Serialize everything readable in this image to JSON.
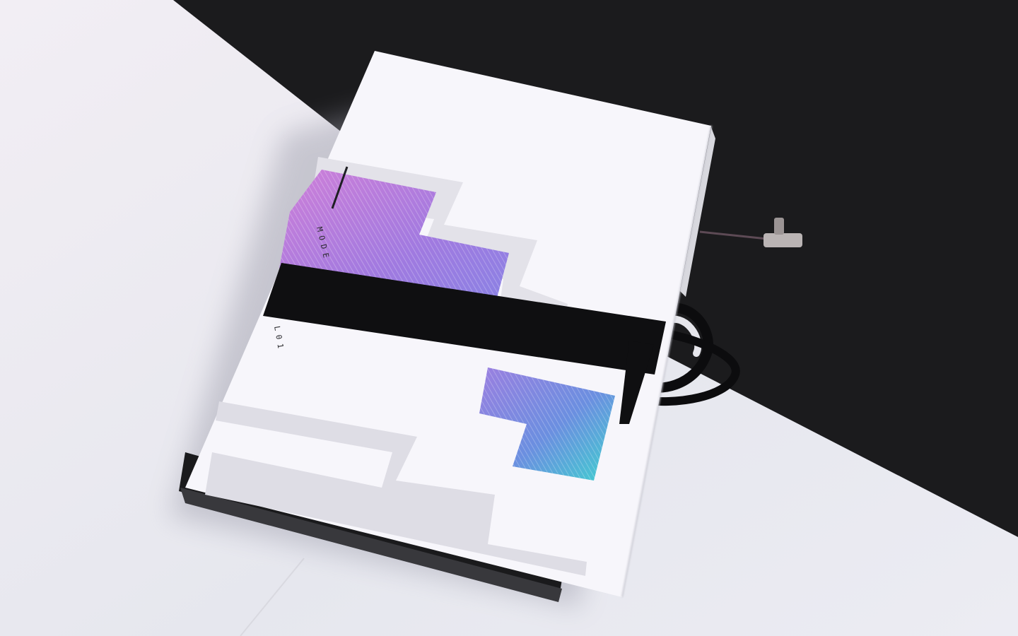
{
  "photo": {
    "subject": "booklet-with-elastic-band",
    "colors": {
      "desk": "#e9e9ef",
      "background_dark": "#1c1c1e",
      "paper": "#f7f6fb",
      "band": "#0e0e10",
      "gradient_top": "#c77bd6",
      "gradient_mid": "#8f74d9",
      "gradient_bottom": "#45c7d0"
    }
  },
  "booklet": {
    "spine_text_top": "MODE",
    "spine_text_bottom": "L01"
  }
}
